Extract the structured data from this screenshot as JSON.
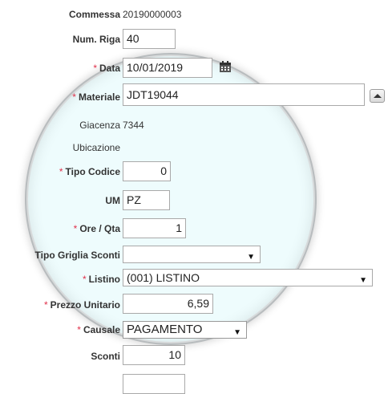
{
  "form": {
    "commessa": {
      "label": "Commessa",
      "value": "20190000003"
    },
    "num_riga": {
      "label": "Num. Riga",
      "value": "40"
    },
    "data": {
      "label": "Data",
      "value": "10/01/2019",
      "required": "*"
    },
    "materiale": {
      "label": "Materiale",
      "value": "JDT19044",
      "required": "*"
    },
    "giacenza": {
      "label": "Giacenza",
      "value": "7344"
    },
    "ubicazione": {
      "label": "Ubicazione",
      "value": ""
    },
    "tipo_codice": {
      "label": "Tipo Codice",
      "value": "0",
      "required": "*"
    },
    "um": {
      "label": "UM",
      "value": "PZ"
    },
    "ore_qta": {
      "label": "Ore / Qta",
      "value": "1",
      "required": "*"
    },
    "tipo_griglia_sconti": {
      "label": "Tipo Griglia Sconti",
      "value": ""
    },
    "listino": {
      "label": "Listino",
      "value": "(001) LISTINO",
      "required": "*"
    },
    "prezzo_unitario": {
      "label": "Prezzo Unitario",
      "value": "6,59",
      "required": "*"
    },
    "causale": {
      "label": "Causale",
      "value": "PAGAMENTO",
      "required": "*"
    },
    "sconti": {
      "label": "Sconti",
      "value": "10"
    },
    "extra": {
      "value": ""
    }
  },
  "icons": {
    "calendar": "calendar-icon",
    "expand": "chevron-up-icon",
    "dropdown": "dropdown-arrow-icon"
  },
  "colors": {
    "required": "#e0304a",
    "lens": "#eefcfd"
  }
}
